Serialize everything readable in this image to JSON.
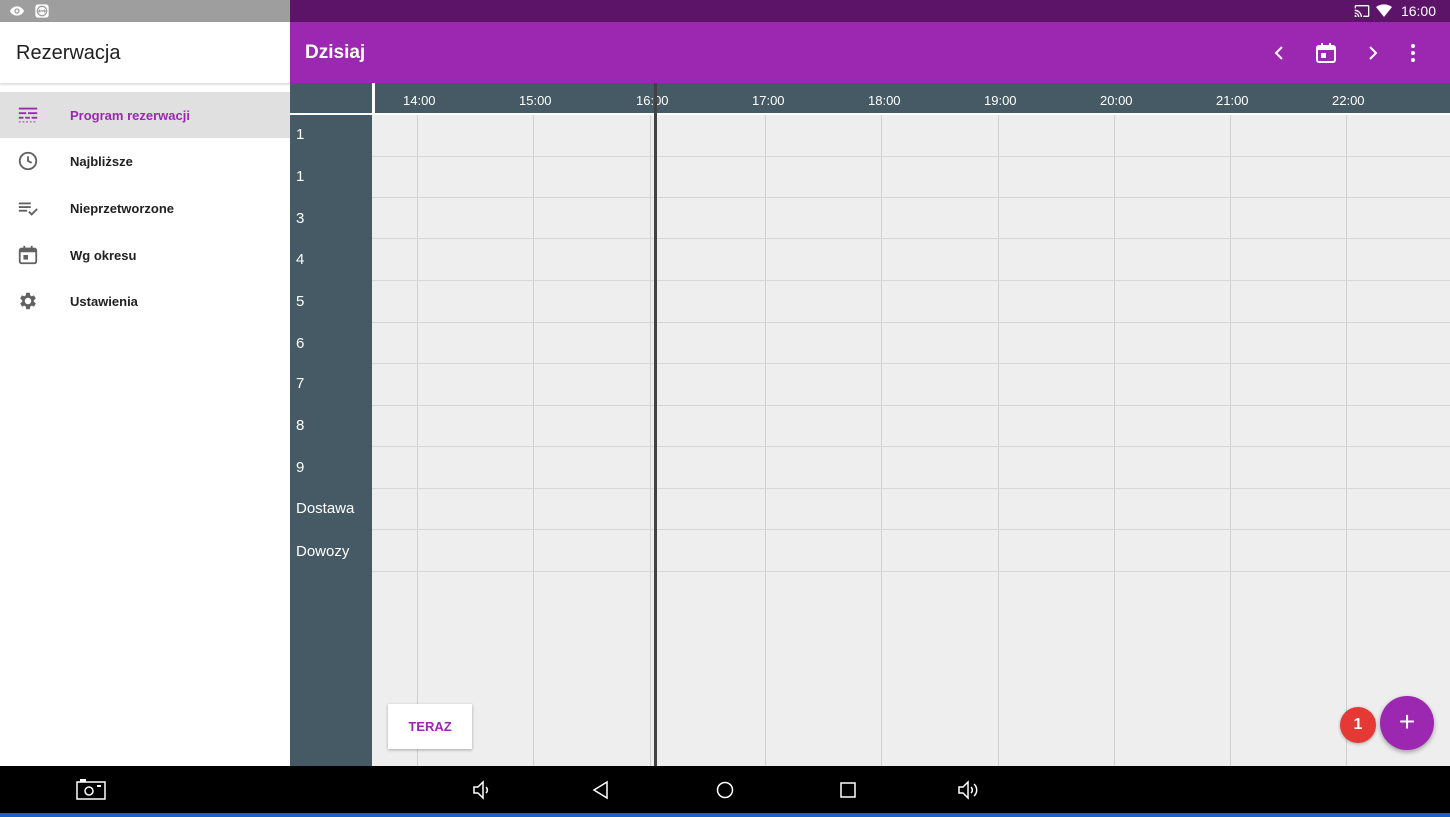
{
  "status_bar": {
    "time": "16:00",
    "left_icons": [
      "eye-icon",
      "teamviewer-icon"
    ],
    "right_icons": [
      "cast-icon",
      "wifi-icon"
    ]
  },
  "drawer": {
    "title": "Rezerwacja",
    "items": [
      {
        "label": "Program rezerwacji",
        "icon": "schedule-grid-icon",
        "active": true
      },
      {
        "label": "Najbliższe",
        "icon": "clock-icon",
        "active": false
      },
      {
        "label": "Nieprzetworzone",
        "icon": "list-check-icon",
        "active": false
      },
      {
        "label": "Wg okresu",
        "icon": "calendar-icon",
        "active": false
      },
      {
        "label": "Ustawienia",
        "icon": "gear-icon",
        "active": false
      }
    ]
  },
  "appbar": {
    "title": "Dzisiaj",
    "actions": [
      "chevron-left-icon",
      "calendar-today-icon",
      "chevron-right-icon",
      "more-vert-icon"
    ]
  },
  "timeline": {
    "hours": [
      "14:00",
      "15:00",
      "16:00",
      "17:00",
      "18:00",
      "19:00",
      "20:00",
      "21:00",
      "22:00"
    ],
    "rows": [
      "1",
      "1",
      "3",
      "4",
      "5",
      "6",
      "7",
      "8",
      "9",
      "Dostawa",
      "Dowozy"
    ],
    "current_time": "16:00"
  },
  "buttons": {
    "teraz": "TERAZ",
    "fab": "+",
    "badge_count": "1"
  },
  "nav_bar": {
    "icons": [
      "screenshot-icon",
      "volume-down-icon",
      "back-icon",
      "home-icon",
      "recents-icon",
      "volume-up-icon"
    ]
  },
  "colors": {
    "primary": "#9c27b0",
    "primary_dark": "#5c1468",
    "slate": "#455a64",
    "badge": "#e53935",
    "grid_bg": "#eeeeee"
  }
}
